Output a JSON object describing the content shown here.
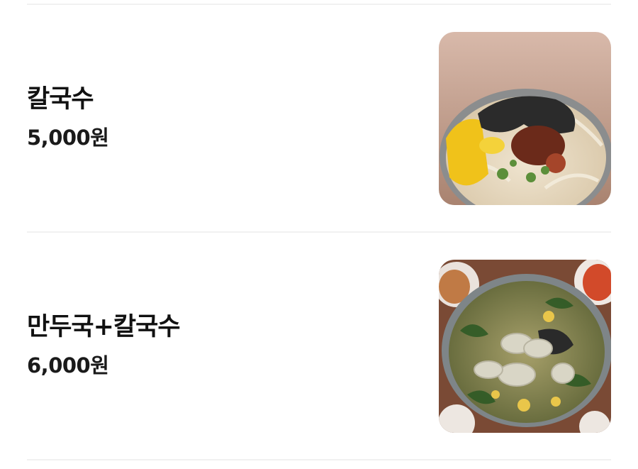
{
  "menu": {
    "items": [
      {
        "name": "칼국수",
        "price": "5,000원",
        "photo_icon": "kalguksu-photo"
      },
      {
        "name": "만두국+칼국수",
        "price": "6,000원",
        "photo_icon": "mandu-kalguksu-photo"
      }
    ]
  }
}
